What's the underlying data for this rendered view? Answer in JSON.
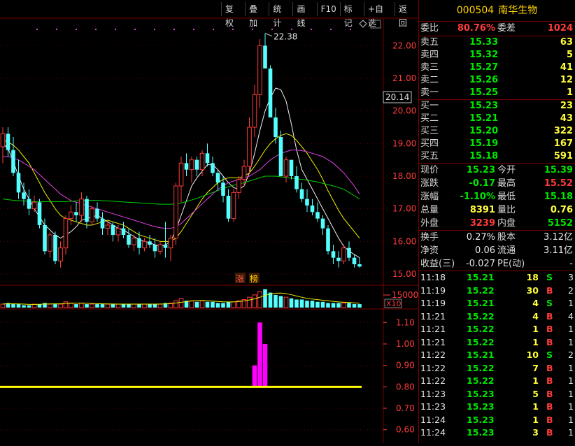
{
  "toolbar": {
    "buttons": [
      "复权",
      "叠加",
      "统计",
      "画线",
      "F10",
      "标记",
      "+自选",
      "返回"
    ]
  },
  "stock": {
    "code": "000504",
    "name": "南华生物"
  },
  "main_chart": {
    "price_axis_labels": [
      "22.00",
      "21.00",
      "20.00",
      "19.00",
      "18.00",
      "17.00",
      "16.00",
      "15.00"
    ],
    "max_marker": "22.38",
    "current_price_tag": "20.14",
    "tags": {
      "zhang": "涨",
      "bang": "榜"
    }
  },
  "volume_chart": {
    "axis_label": "15000",
    "multiplier": "X10"
  },
  "indicator_chart": {
    "axis_labels": [
      "1.10",
      "1.00",
      "0.90",
      "0.80",
      "0.70",
      "0.60"
    ],
    "baseline_color": "#ffff00",
    "bar_color": "#ff00ff"
  },
  "chart_data": [
    {
      "type": "candlestick",
      "ylim": [
        14.7,
        22.8
      ],
      "up_color": "#ff3b3b",
      "down_color": "#54ffff",
      "candles": [
        [
          0,
          18.9,
          19.5,
          18.4,
          19.3
        ],
        [
          1,
          19.3,
          19.5,
          18.6,
          18.8
        ],
        [
          2,
          18.8,
          19.2,
          18.0,
          18.1
        ],
        [
          3,
          18.1,
          18.5,
          17.3,
          17.5
        ],
        [
          4,
          17.5,
          17.8,
          17.1,
          17.3
        ],
        [
          5,
          17.3,
          17.6,
          16.8,
          17.0
        ],
        [
          6,
          17.0,
          17.4,
          16.9,
          17.2
        ],
        [
          7,
          17.2,
          17.3,
          16.4,
          16.5
        ],
        [
          8,
          16.5,
          16.7,
          15.6,
          15.7
        ],
        [
          9,
          15.7,
          16.3,
          15.5,
          16.2
        ],
        [
          10,
          16.2,
          16.3,
          15.3,
          15.4
        ],
        [
          11,
          15.4,
          16.0,
          15.2,
          15.8
        ],
        [
          12,
          15.8,
          16.8,
          15.6,
          16.7
        ],
        [
          13,
          16.7,
          17.1,
          16.5,
          16.9
        ],
        [
          14,
          16.9,
          17.2,
          16.6,
          16.8
        ],
        [
          15,
          16.8,
          17.5,
          16.6,
          17.3
        ],
        [
          16,
          17.3,
          17.4,
          16.4,
          16.6
        ],
        [
          17,
          16.6,
          17.1,
          16.5,
          17.0
        ],
        [
          18,
          17.0,
          17.2,
          16.6,
          16.7
        ],
        [
          19,
          16.7,
          16.9,
          16.2,
          16.4
        ],
        [
          20,
          16.4,
          16.6,
          16.2,
          16.5
        ],
        [
          21,
          16.5,
          16.6,
          16.0,
          16.2
        ],
        [
          22,
          16.2,
          16.5,
          16.0,
          16.4
        ],
        [
          23,
          16.4,
          16.6,
          16.1,
          16.2
        ],
        [
          24,
          16.2,
          16.4,
          15.8,
          15.9
        ],
        [
          25,
          15.9,
          16.2,
          15.7,
          16.1
        ],
        [
          26,
          16.1,
          16.3,
          15.6,
          15.8
        ],
        [
          27,
          15.8,
          16.1,
          15.7,
          16.0
        ],
        [
          28,
          16.0,
          16.2,
          15.8,
          15.9
        ],
        [
          29,
          15.9,
          16.1,
          15.5,
          15.7
        ],
        [
          30,
          15.7,
          16.0,
          15.6,
          15.9
        ],
        [
          31,
          15.9,
          16.6,
          15.5,
          15.8
        ],
        [
          32,
          15.8,
          16.2,
          15.4,
          16.1
        ],
        [
          33,
          16.1,
          17.8,
          15.9,
          17.7
        ],
        [
          34,
          17.7,
          18.6,
          17.2,
          18.4
        ],
        [
          35,
          18.4,
          18.7,
          18.0,
          18.2
        ],
        [
          36,
          18.2,
          18.6,
          17.8,
          18.5
        ],
        [
          37,
          18.5,
          18.6,
          18.0,
          18.2
        ],
        [
          38,
          18.2,
          18.8,
          18.0,
          18.7
        ],
        [
          39,
          18.7,
          19.0,
          18.3,
          18.4
        ],
        [
          40,
          18.4,
          18.6,
          18.0,
          18.1
        ],
        [
          41,
          18.1,
          18.2,
          17.6,
          17.8
        ],
        [
          42,
          17.8,
          18.0,
          17.2,
          17.4
        ],
        [
          43,
          17.4,
          17.6,
          16.6,
          16.7
        ],
        [
          44,
          16.7,
          17.6,
          16.6,
          17.5
        ],
        [
          45,
          17.5,
          18.0,
          17.3,
          17.9
        ],
        [
          46,
          17.9,
          18.5,
          17.7,
          18.3
        ],
        [
          47,
          18.3,
          19.8,
          18.1,
          19.5
        ],
        [
          48,
          19.5,
          20.8,
          19.2,
          20.5
        ],
        [
          49,
          20.5,
          22.2,
          20.1,
          22.0
        ],
        [
          50,
          22.0,
          22.38,
          21.5,
          21.3
        ],
        [
          51,
          21.3,
          21.4,
          20.0,
          19.8
        ],
        [
          52,
          19.8,
          20.1,
          19.0,
          19.2
        ],
        [
          53,
          19.2,
          19.4,
          18.0,
          18.0
        ],
        [
          54,
          18.0,
          18.6,
          17.8,
          18.5
        ],
        [
          55,
          18.5,
          18.5,
          17.9,
          18.0
        ],
        [
          56,
          18.0,
          18.3,
          17.5,
          17.6
        ],
        [
          57,
          17.6,
          17.8,
          17.2,
          17.3
        ],
        [
          58,
          17.3,
          17.6,
          16.9,
          17.1
        ],
        [
          59,
          17.1,
          17.3,
          16.8,
          16.9
        ],
        [
          60,
          16.9,
          17.2,
          16.6,
          16.7
        ],
        [
          61,
          16.7,
          16.8,
          16.2,
          16.4
        ],
        [
          62,
          16.4,
          16.5,
          15.6,
          15.7
        ],
        [
          63,
          15.7,
          15.9,
          15.3,
          15.5
        ],
        [
          64,
          15.5,
          15.7,
          15.2,
          15.4
        ],
        [
          65,
          15.4,
          15.9,
          15.3,
          15.8
        ],
        [
          66,
          15.8,
          16.0,
          15.4,
          15.5
        ],
        [
          67,
          15.5,
          15.6,
          15.2,
          15.3
        ],
        [
          68,
          15.3,
          15.5,
          15.2,
          15.23
        ]
      ],
      "ma_lines": [
        {
          "color": "#f0f0f0",
          "values": [
            19.0,
            18.85,
            18.45,
            18.0,
            17.6,
            17.3,
            17.0,
            16.75,
            16.5,
            16.35,
            16.2,
            16.1,
            16.2,
            16.3,
            16.45,
            16.65,
            16.7,
            16.75,
            16.8,
            16.7,
            16.6,
            16.5,
            16.4,
            16.35,
            16.25,
            16.15,
            16.05,
            16.0,
            15.95,
            15.9,
            15.85,
            15.9,
            16.0,
            16.35,
            16.8,
            17.25,
            17.7,
            17.95,
            18.15,
            18.35,
            18.35,
            18.2,
            18.0,
            17.8,
            17.65,
            17.6,
            17.7,
            18.1,
            18.7,
            19.4,
            20.0,
            20.4,
            20.7,
            20.65,
            20.3,
            19.6,
            18.8,
            18.2,
            17.9,
            17.6,
            17.3,
            17.0,
            16.7,
            16.4,
            16.1,
            15.85,
            15.7,
            15.6,
            15.5
          ]
        },
        {
          "color": "#f0f000",
          "values": [
            19.1,
            19.05,
            18.95,
            18.8,
            18.6,
            18.4,
            18.1,
            17.8,
            17.5,
            17.25,
            17.0,
            16.8,
            16.7,
            16.65,
            16.6,
            16.55,
            16.5,
            16.5,
            16.55,
            16.6,
            16.65,
            16.6,
            16.55,
            16.5,
            16.4,
            16.3,
            16.2,
            16.15,
            16.1,
            16.05,
            16.0,
            16.0,
            16.0,
            16.1,
            16.3,
            16.55,
            16.8,
            17.05,
            17.3,
            17.5,
            17.65,
            17.8,
            17.9,
            17.95,
            17.95,
            17.95,
            18.0,
            18.1,
            18.3,
            18.55,
            18.8,
            19.0,
            19.15,
            19.25,
            19.3,
            19.25,
            19.1,
            18.9,
            18.7,
            18.45,
            18.2,
            17.9,
            17.55,
            17.25,
            16.95,
            16.7,
            16.5,
            16.3,
            16.1
          ]
        },
        {
          "color": "#e040e0",
          "values": [
            18.6,
            18.6,
            18.55,
            18.5,
            18.4,
            18.3,
            18.2,
            18.05,
            17.9,
            17.75,
            17.6,
            17.45,
            17.35,
            17.25,
            17.2,
            17.15,
            17.1,
            17.05,
            17.0,
            16.95,
            16.9,
            16.85,
            16.8,
            16.75,
            16.7,
            16.65,
            16.6,
            16.55,
            16.5,
            16.45,
            16.42,
            16.4,
            16.4,
            16.45,
            16.55,
            16.7,
            16.85,
            17.0,
            17.15,
            17.3,
            17.45,
            17.6,
            17.7,
            17.8,
            17.85,
            17.9,
            17.95,
            18.0,
            18.1,
            18.2,
            18.35,
            18.5,
            18.6,
            18.7,
            18.75,
            18.8,
            18.8,
            18.78,
            18.75,
            18.7,
            18.65,
            18.6,
            18.5,
            18.4,
            18.25,
            18.1,
            17.9,
            17.7,
            17.45
          ]
        },
        {
          "color": "#00d000",
          "values": [
            17.3,
            17.28,
            17.26,
            17.25,
            17.24,
            17.23,
            17.22,
            17.22,
            17.22,
            17.22,
            17.22,
            17.22,
            17.22,
            17.23,
            17.24,
            17.25,
            17.26,
            17.26,
            17.26,
            17.25,
            17.24,
            17.23,
            17.22,
            17.21,
            17.2,
            17.19,
            17.18,
            17.17,
            17.16,
            17.15,
            17.14,
            17.14,
            17.14,
            17.15,
            17.18,
            17.22,
            17.27,
            17.32,
            17.38,
            17.44,
            17.5,
            17.56,
            17.62,
            17.68,
            17.72,
            17.76,
            17.8,
            17.85,
            17.9,
            17.95,
            18.0,
            18.0,
            18.0,
            17.98,
            17.96,
            17.94,
            17.92,
            17.9,
            17.88,
            17.85,
            17.82,
            17.78,
            17.74,
            17.7,
            17.65,
            17.6,
            17.5,
            17.4,
            17.3
          ]
        }
      ]
    },
    {
      "type": "bar",
      "name": "volume",
      "values": [
        3,
        4,
        3,
        3,
        2,
        2,
        3,
        3,
        4,
        3,
        3,
        3,
        5,
        4,
        3,
        4,
        3,
        3,
        3,
        3,
        3,
        3,
        3,
        3,
        3,
        3,
        3,
        3,
        3,
        3,
        3,
        4,
        4,
        6,
        8,
        6,
        6,
        5,
        6,
        5,
        5,
        4,
        4,
        5,
        5,
        6,
        7,
        9,
        11,
        14,
        16,
        13,
        11,
        10,
        9,
        8,
        7,
        7,
        6,
        6,
        5,
        5,
        4,
        4,
        4,
        4,
        4,
        3,
        3
      ],
      "ma_values": [
        3.2,
        3.3,
        3.3,
        3.2,
        3.0,
        2.8,
        2.7,
        2.9,
        3.1,
        3.2,
        3.3,
        3.3,
        3.6,
        3.7,
        3.8,
        3.8,
        3.8,
        3.6,
        3.4,
        3.3,
        3.2,
        3.1,
        3.0,
        3.0,
        3.0,
        3.0,
        3.0,
        3.0,
        3.0,
        3.0,
        3.1,
        3.2,
        3.5,
        4.0,
        4.6,
        5.2,
        5.8,
        6.1,
        6.2,
        5.9,
        5.6,
        5.3,
        5.0,
        4.9,
        4.9,
        5.2,
        5.8,
        6.6,
        7.6,
        9.0,
        10.6,
        11.8,
        12.5,
        12.6,
        12.1,
        11.2,
        10.0,
        9.0,
        8.0,
        7.4,
        6.9,
        6.4,
        5.9,
        5.4,
        4.9,
        4.6,
        4.4,
        4.1,
        3.8
      ]
    },
    {
      "type": "bar",
      "name": "indicator",
      "ylim": [
        0.55,
        1.15
      ],
      "baseline": 0.8,
      "bars": [
        [
          48,
          0.9
        ],
        [
          49,
          1.1
        ],
        [
          50,
          1.0
        ]
      ]
    }
  ],
  "quote": {
    "weibi": {
      "label": "委比",
      "value": "80.76%"
    },
    "weicha": {
      "label": "委差",
      "value": "1024"
    },
    "asks": [
      {
        "label": "卖五",
        "price": "15.33",
        "vol": "63"
      },
      {
        "label": "卖四",
        "price": "15.32",
        "vol": "5"
      },
      {
        "label": "卖三",
        "price": "15.27",
        "vol": "41"
      },
      {
        "label": "卖二",
        "price": "15.26",
        "vol": "12"
      },
      {
        "label": "卖一",
        "price": "15.25",
        "vol": "1"
      }
    ],
    "bids": [
      {
        "label": "买一",
        "price": "15.23",
        "vol": "23"
      },
      {
        "label": "买二",
        "price": "15.21",
        "vol": "43"
      },
      {
        "label": "买三",
        "price": "15.20",
        "vol": "322"
      },
      {
        "label": "买四",
        "price": "15.19",
        "vol": "167"
      },
      {
        "label": "买五",
        "price": "15.18",
        "vol": "591"
      }
    ],
    "stats": [
      {
        "l1": "现价",
        "v1": "15.23",
        "c1": "green",
        "l2": "今开",
        "v2": "15.39",
        "c2": "green"
      },
      {
        "l1": "涨跌",
        "v1": "-0.17",
        "c1": "green",
        "l2": "最高",
        "v2": "15.52",
        "c2": "red"
      },
      {
        "l1": "涨幅",
        "v1": "-1.10%",
        "c1": "green",
        "l2": "最低",
        "v2": "15.18",
        "c2": "green"
      },
      {
        "l1": "总量",
        "v1": "8391",
        "c1": "yellow",
        "l2": "量比",
        "v2": "0.76",
        "c2": "yellow"
      },
      {
        "l1": "外盘",
        "v1": "3239",
        "c1": "red",
        "l2": "内盘",
        "v2": "5152",
        "c2": "green"
      }
    ],
    "stats2": [
      {
        "l1": "换手",
        "v1": "0.27%",
        "l2": "股本",
        "v2": "3.12亿"
      },
      {
        "l1": "净资",
        "v1": "0.06",
        "l2": "流通",
        "v2": "3.11亿"
      },
      {
        "l1": "收益(三)",
        "v1": "-0.027",
        "l2": "PE(动)",
        "v2": "-"
      }
    ]
  },
  "ticks": [
    {
      "time": "11:18",
      "price": "15.21",
      "vol": "18",
      "side": "S",
      "n": "3"
    },
    {
      "time": "11:19",
      "price": "15.22",
      "vol": "30",
      "side": "B",
      "n": "2"
    },
    {
      "time": "11:19",
      "price": "15.21",
      "vol": "4",
      "side": "S",
      "n": "1"
    },
    {
      "time": "11:21",
      "price": "15.22",
      "vol": "4",
      "side": "B",
      "n": "4"
    },
    {
      "time": "11:21",
      "price": "15.22",
      "vol": "1",
      "side": "B",
      "n": "1"
    },
    {
      "time": "11:21",
      "price": "15.22",
      "vol": "1",
      "side": "B",
      "n": "1"
    },
    {
      "time": "11:22",
      "price": "15.21",
      "vol": "10",
      "side": "S",
      "n": "2"
    },
    {
      "time": "11:22",
      "price": "15.22",
      "vol": "7",
      "side": "B",
      "n": "1"
    },
    {
      "time": "11:22",
      "price": "15.22",
      "vol": "1",
      "side": "B",
      "n": "1"
    },
    {
      "time": "11:23",
      "price": "15.23",
      "vol": "5",
      "side": "B",
      "n": "1"
    },
    {
      "time": "11:23",
      "price": "15.23",
      "vol": "1",
      "side": "B",
      "n": "1"
    },
    {
      "time": "11:24",
      "price": "15.23",
      "vol": "1",
      "side": "B",
      "n": "1"
    },
    {
      "time": "11:24",
      "price": "15.23",
      "vol": "3",
      "side": "B",
      "n": "1"
    }
  ]
}
